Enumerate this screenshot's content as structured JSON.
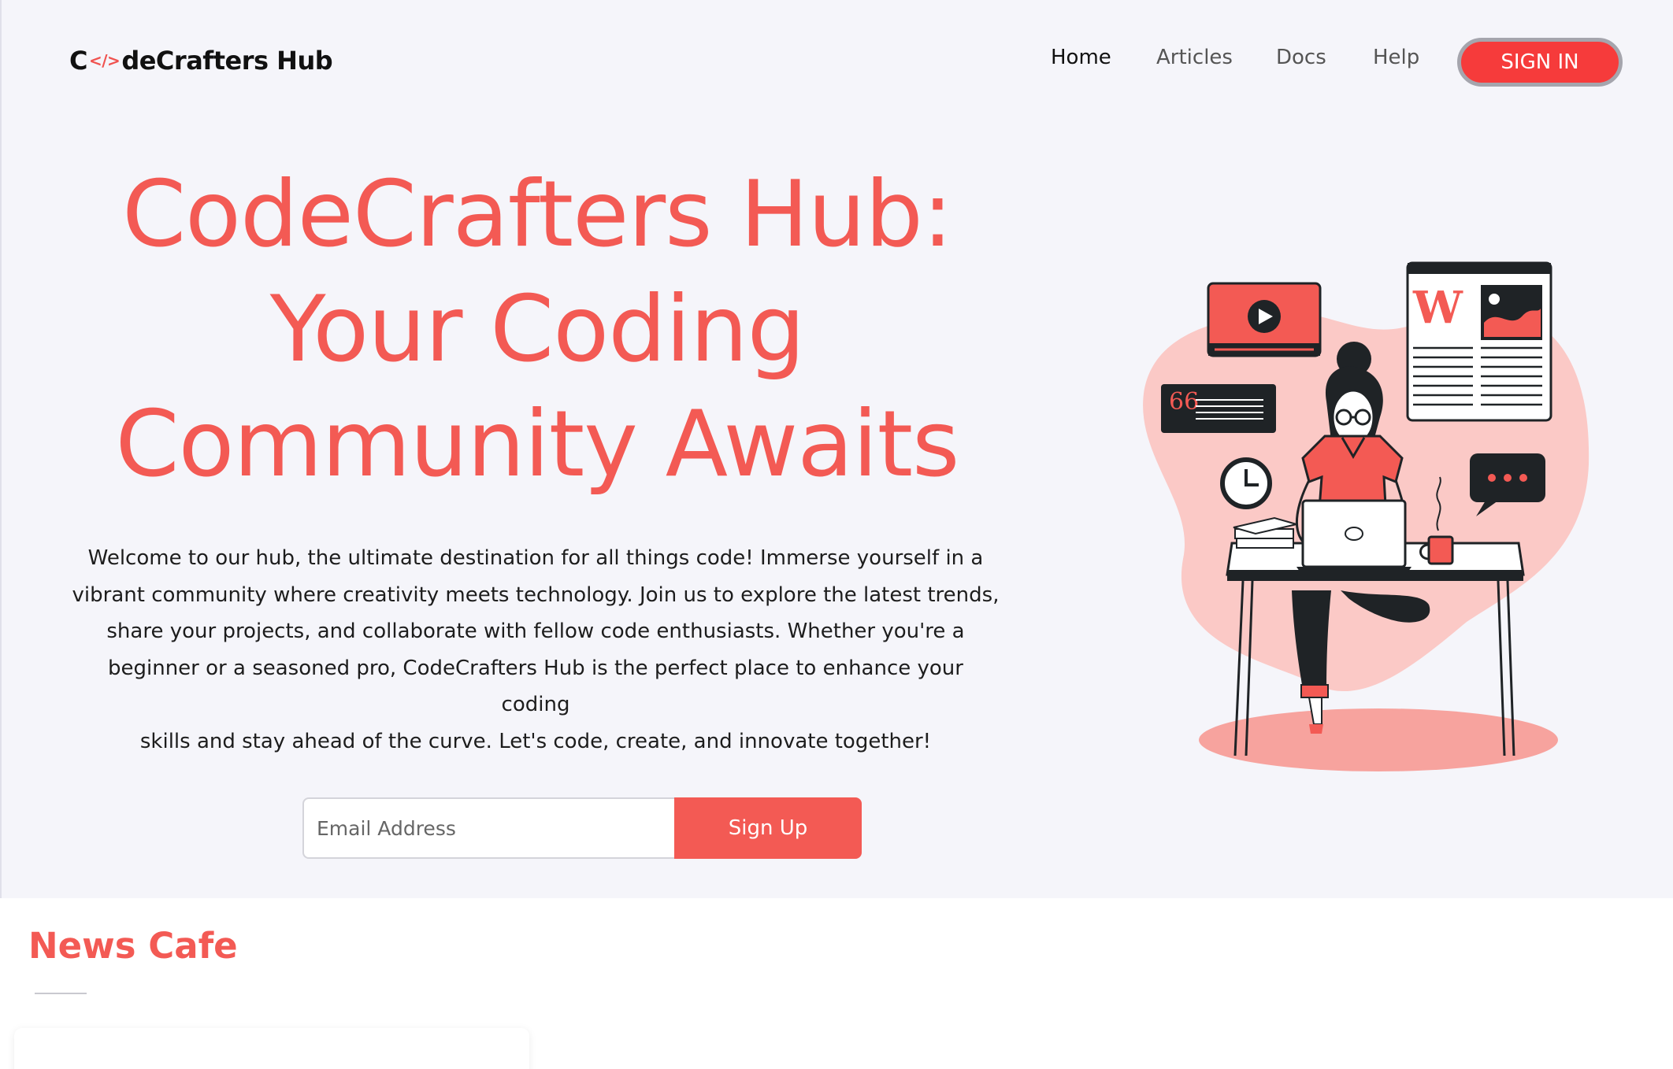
{
  "header": {
    "logo_prefix": "C",
    "logo_glyph": "</>",
    "logo_suffix": "deCrafters Hub",
    "nav": [
      {
        "label": "Home",
        "active": true
      },
      {
        "label": "Articles",
        "active": false
      },
      {
        "label": "Docs",
        "active": false
      },
      {
        "label": "Help",
        "active": false
      }
    ],
    "signin_label": "SIGN IN"
  },
  "hero": {
    "title_line1": "CodeCrafters Hub:",
    "title_line2": "Your Coding",
    "title_line3": "Community Awaits",
    "description_lines": [
      "Welcome to our hub, the ultimate destination for all things code! Immerse yourself in a",
      "vibrant community where creativity meets technology. Join us to explore the latest trends,",
      "share your projects, and collaborate with fellow code enthusiasts. Whether you're a",
      "beginner or a seasoned pro, CodeCrafters Hub is the perfect place to enhance your coding",
      "skills and stay ahead of the curve. Let's code, create, and innovate together!"
    ],
    "email_placeholder": "Email Address",
    "signup_label": "Sign Up",
    "illustration_icons": [
      "video-play-icon",
      "wiki-article-icon",
      "quote-icon",
      "clock-icon",
      "chat-bubble-icon",
      "laptop-icon",
      "coffee-mug-icon"
    ]
  },
  "news": {
    "title": "News Cafe"
  },
  "colors": {
    "accent": "#f35a54",
    "signin": "#f63b3b",
    "hero_bg": "#f5f5fa",
    "blob": "#fbc9c6",
    "dark": "#1f2326"
  }
}
